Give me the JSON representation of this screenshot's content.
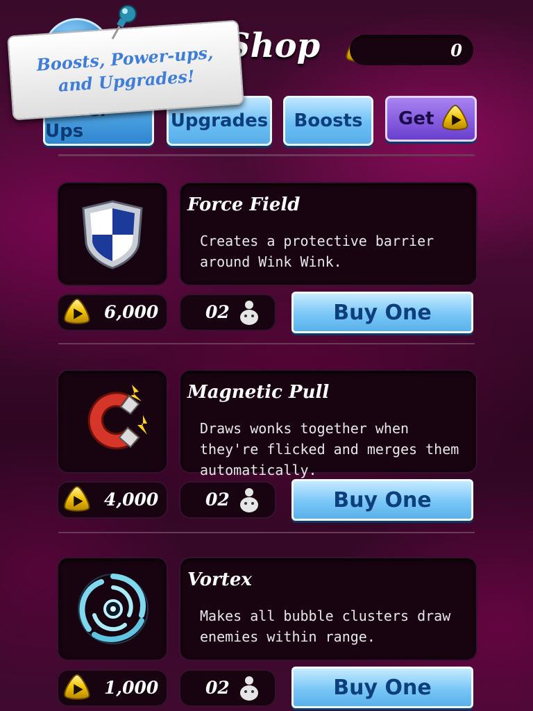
{
  "header": {
    "title": "Shop",
    "currency_balance": "0",
    "promo_text_line1": "Boosts, Power-ups,",
    "promo_text_line2": "and Upgrades!"
  },
  "tabs": [
    {
      "label": "Power-Ups",
      "active": true
    },
    {
      "label": "Upgrades",
      "active": false
    },
    {
      "label": "Boosts",
      "active": false
    },
    {
      "label": "Get",
      "active": false
    }
  ],
  "items": [
    {
      "name": "Force Field",
      "description": "Creates a protective barrier around Wink Wink.",
      "price": "6,000",
      "owned": "02",
      "button": "Buy One",
      "icon": "shield-icon"
    },
    {
      "name": "Magnetic Pull",
      "description": "Draws wonks together when they're flicked and merges them automatically.",
      "price": "4,000",
      "owned": "02",
      "button": "Buy One",
      "icon": "magnet-icon"
    },
    {
      "name": "Vortex",
      "description": "Makes all bubble clusters draw enemies within range.",
      "price": "1,000",
      "owned": "02",
      "button": "Buy One",
      "icon": "vortex-icon"
    }
  ],
  "colors": {
    "accent_blue": "#6cbef5",
    "coin_gold": "#f2c200",
    "get_purple": "#7a4fdc"
  }
}
